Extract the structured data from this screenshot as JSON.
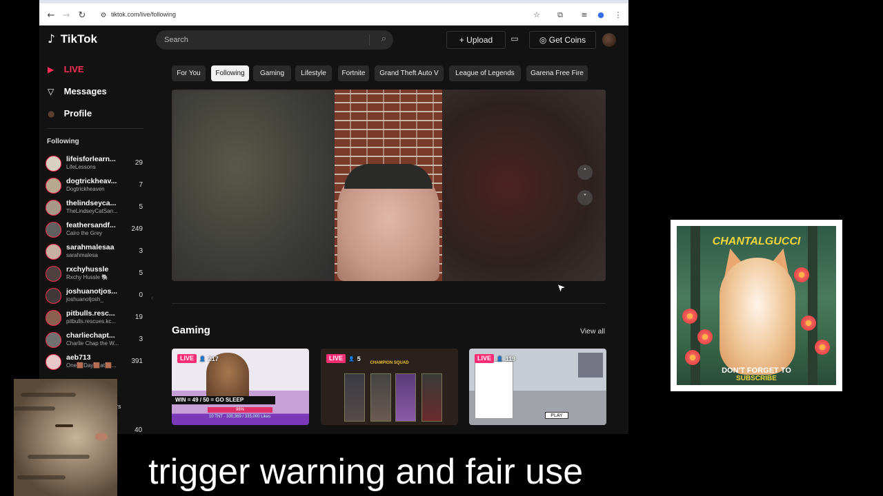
{
  "browser": {
    "url": "tiktok.com/live/following",
    "icons": {
      "back": "←",
      "forward": "→",
      "reload": "↻",
      "site_info": "⚙",
      "star": "☆",
      "extensions": "⧉",
      "media": "≡",
      "profile": "●",
      "menu": "⋮"
    }
  },
  "header": {
    "logo_icon": "♪",
    "logo_text": "TikTok",
    "search_placeholder": "Search",
    "search_icon": "⌕",
    "upload_label": "Upload",
    "upload_icon": "+",
    "inbox_icon": "▭",
    "coins_label": "Get Coins",
    "coins_icon": "◎"
  },
  "sidebar": {
    "main_items": [
      {
        "icon": "▶",
        "label": "LIVE",
        "color": "#ff2d55"
      },
      {
        "icon": "▽",
        "label": "Messages",
        "color": "#ffffff"
      },
      {
        "icon": "●",
        "label": "Profile",
        "color": "#ffffff"
      }
    ],
    "following_label": "Following",
    "following": [
      {
        "name": "lifeisforlearn...",
        "sub": "LifeLessons",
        "count": "29"
      },
      {
        "name": "dogtrickheav...",
        "sub": "Dogtrickheaven",
        "count": "7"
      },
      {
        "name": "thelindseyca...",
        "sub": "TheLindseyCatSan...",
        "count": "5"
      },
      {
        "name": "feathersandf...",
        "sub": "Cairo the Grey",
        "count": "249"
      },
      {
        "name": "sarahmalesaa",
        "sub": "sarahmalesa",
        "count": "3"
      },
      {
        "name": "rxchyhussle",
        "sub": "Rxchy Hussle 🐘",
        "count": "5"
      },
      {
        "name": "joshuanotjos...",
        "sub": "joshuanotjosh_",
        "count": "0"
      },
      {
        "name": "pitbulls.resc...",
        "sub": "pitbulls.rescues.kc...",
        "count": "19"
      },
      {
        "name": "charliechapt...",
        "sub": "Charlie Chap the W...",
        "count": "3"
      },
      {
        "name": "aeb713",
        "sub": "One🟫Day🟫at🟫...",
        "count": "391"
      }
    ],
    "hidden_tail": "rs",
    "hidden_count": "40",
    "collapse_icon": "‹"
  },
  "main": {
    "chips": [
      {
        "label": "For You",
        "active": false
      },
      {
        "label": "Following",
        "active": true
      },
      {
        "label": "Gaming",
        "active": false
      },
      {
        "label": "Lifestyle",
        "active": false
      },
      {
        "label": "Fortnite",
        "active": false
      },
      {
        "label": "Grand Theft Auto V",
        "active": false
      },
      {
        "label": "League of Legends",
        "active": false
      },
      {
        "label": "Garena Free Fire",
        "active": false
      }
    ],
    "chip_next_icon": "›",
    "player": {
      "up_icon": "˄",
      "down_icon": "˅"
    },
    "gaming_title": "Gaming",
    "view_all": "View all",
    "thumbs": [
      {
        "live": "LIVE",
        "viewers": "217",
        "banner": "WIN = 49 / 50 = GO SLEEP",
        "bar": "98%",
        "foot": "10 TNT · 330,369 / 335,000 Likes"
      },
      {
        "live": "LIVE",
        "viewers": "5",
        "title": "CHAMPION SQUAD"
      },
      {
        "live": "LIVE",
        "viewers": "119",
        "play": "PLAY"
      }
    ],
    "viewer_icon": "👤"
  },
  "overlay": {
    "cursor_icon": "➤",
    "poster_top": "CHANTALGUCCI",
    "poster_bottom_1": "DON'T FORGET TO",
    "poster_bottom_2": "SUBSCRIBE",
    "caption": "trigger warning and fair use"
  },
  "colors": {
    "accent": "#ff2d55",
    "live_badge": "#ff2d74",
    "bg": "#121212"
  }
}
